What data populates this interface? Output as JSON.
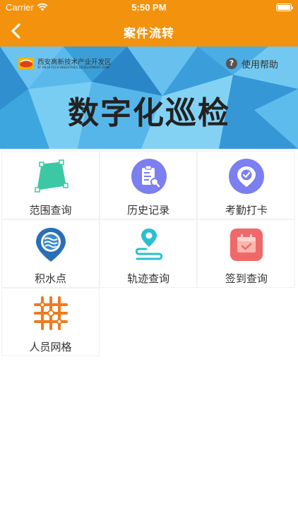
{
  "status_bar": {
    "carrier": "Carrier",
    "time": "5:50 PM"
  },
  "nav": {
    "title": "案件流转"
  },
  "banner": {
    "org_name_cn": "西安高新技术产业开发区",
    "org_name_en": "XI' AN HI-TECH INDUSTRIES DEVELOPMENT ZONE",
    "help_label": "使用帮助",
    "title": "数字化巡检"
  },
  "menu": {
    "items": [
      {
        "label": "范围查询",
        "icon": "area-polygon-icon"
      },
      {
        "label": "历史记录",
        "icon": "history-clipboard-icon"
      },
      {
        "label": "考勤打卡",
        "icon": "attendance-checkin-icon"
      },
      {
        "label": "积水点",
        "icon": "waterlogging-pin-icon"
      },
      {
        "label": "轨迹查询",
        "icon": "track-route-icon"
      },
      {
        "label": "签到查询",
        "icon": "signin-calendar-icon"
      },
      {
        "label": "人员网格",
        "icon": "personnel-grid-icon"
      }
    ]
  },
  "colors": {
    "accent": "#f2920d"
  }
}
